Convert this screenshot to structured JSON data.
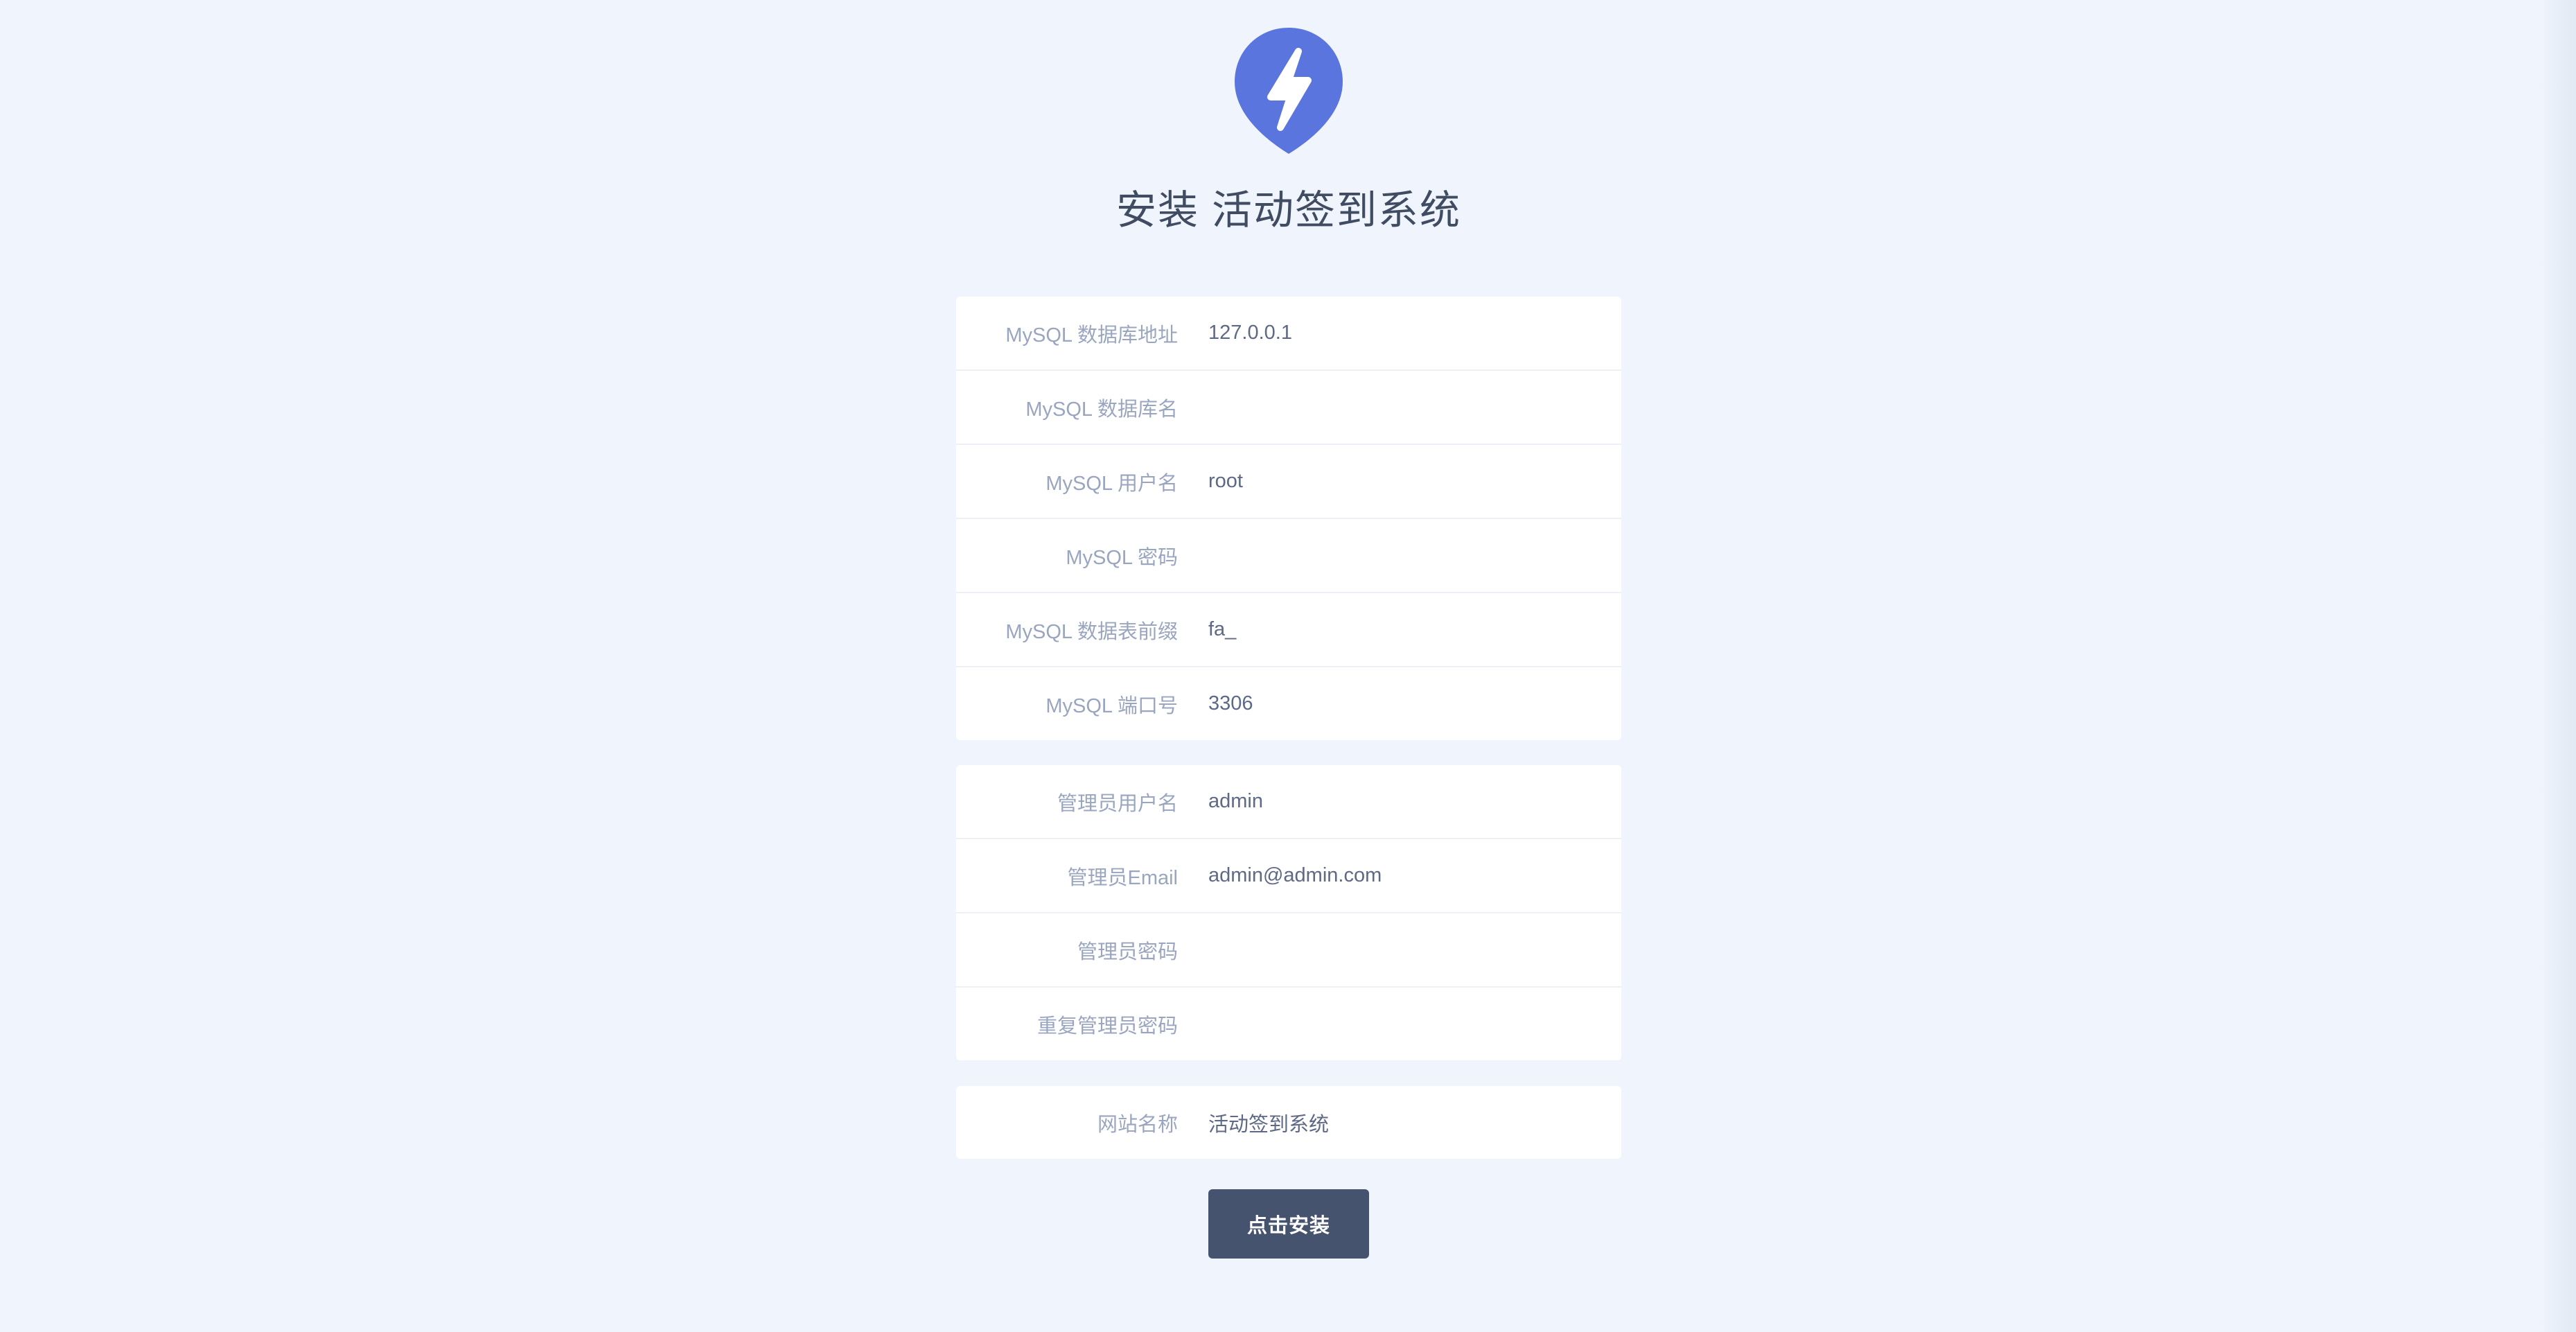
{
  "title": "安装 活动签到系统",
  "colors": {
    "background": "#f0f5fd",
    "logo": "#5b75df",
    "button": "#45536e",
    "title": "#3f4c62",
    "label": "#9aa6c0",
    "value": "#5d6985"
  },
  "logo_icon": "lightning-bolt-icon",
  "database": {
    "host": {
      "label": "MySQL 数据库地址",
      "value": "127.0.0.1",
      "placeholder": ""
    },
    "name": {
      "label": "MySQL 数据库名",
      "value": "",
      "placeholder": ""
    },
    "user": {
      "label": "MySQL 用户名",
      "value": "root",
      "placeholder": ""
    },
    "password": {
      "label": "MySQL 密码",
      "value": "",
      "placeholder": ""
    },
    "prefix": {
      "label": "MySQL 数据表前缀",
      "value": "fa_",
      "placeholder": ""
    },
    "port": {
      "label": "MySQL 端口号",
      "value": "3306",
      "placeholder": ""
    }
  },
  "admin": {
    "username": {
      "label": "管理员用户名",
      "value": "admin",
      "placeholder": ""
    },
    "email": {
      "label": "管理员Email",
      "value": "admin@admin.com",
      "placeholder": ""
    },
    "password": {
      "label": "管理员密码",
      "value": "",
      "placeholder": ""
    },
    "password_repeat": {
      "label": "重复管理员密码",
      "value": "",
      "placeholder": ""
    }
  },
  "site": {
    "name": {
      "label": "网站名称",
      "value": "活动签到系统",
      "placeholder": ""
    }
  },
  "install_button": "点击安装"
}
